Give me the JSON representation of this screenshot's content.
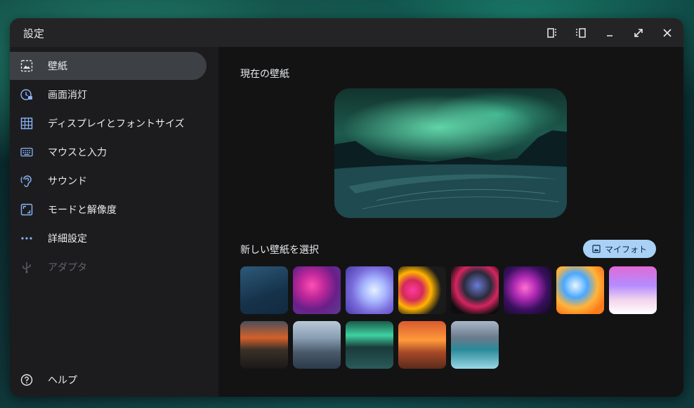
{
  "window": {
    "title": "設定",
    "controls": [
      "snap-left-icon",
      "snap-right-icon",
      "minimize-icon",
      "maximize-icon",
      "close-icon"
    ]
  },
  "sidebar": {
    "items": [
      {
        "label": "壁紙",
        "icon": "wallpaper-icon",
        "active": true
      },
      {
        "label": "画面消灯",
        "icon": "screen-saver-icon",
        "active": false
      },
      {
        "label": "ディスプレイとフォントサイズ",
        "icon": "display-grid-icon",
        "active": false
      },
      {
        "label": "マウスと入力",
        "icon": "keyboard-icon",
        "active": false
      },
      {
        "label": "サウンド",
        "icon": "hearing-icon",
        "active": false
      },
      {
        "label": "モードと解像度",
        "icon": "resolution-icon",
        "active": false
      },
      {
        "label": "詳細設定",
        "icon": "more-icon",
        "active": false
      },
      {
        "label": "アダプタ",
        "icon": "usb-icon",
        "active": false,
        "disabled": true
      }
    ],
    "help": {
      "label": "ヘルプ",
      "icon": "help-icon"
    }
  },
  "main": {
    "current_title": "現在の壁紙",
    "choose_title": "新しい壁紙を選択",
    "my_photo_label": "マイフォト"
  },
  "colors": {
    "accent": "#a8d1f5",
    "window_bg": "#1c1c1e",
    "main_bg": "#131314",
    "active_item": "#3d4146"
  }
}
